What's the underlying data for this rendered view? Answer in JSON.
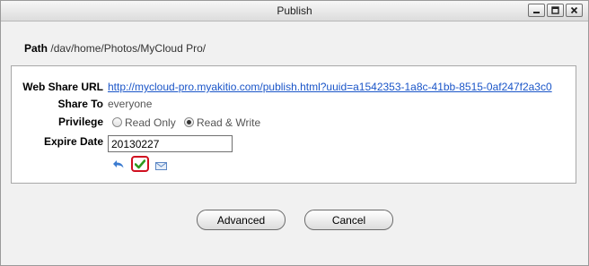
{
  "window": {
    "title": "Publish",
    "controls": [
      "minimize-icon",
      "maximize-icon",
      "close-icon"
    ]
  },
  "path": {
    "label": "Path",
    "value": "/dav/home/Photos/MyCloud Pro/"
  },
  "form": {
    "web_share_url": {
      "label": "Web Share URL",
      "value": "http://mycloud-pro.myakitio.com/publish.html?uuid=a1542353-1a8c-41bb-8515-0af247f2a3c0"
    },
    "share_to": {
      "label": "Share To",
      "value": "everyone"
    },
    "privilege": {
      "label": "Privilege",
      "options": [
        {
          "label": "Read Only",
          "checked": false
        },
        {
          "label": "Read & Write",
          "checked": true
        }
      ]
    },
    "expire_date": {
      "label": "Expire Date",
      "value": "20130227"
    },
    "actions": [
      "undo-icon",
      "confirm-check-icon",
      "email-icon"
    ]
  },
  "buttons": {
    "advanced": "Advanced",
    "cancel": "Cancel"
  },
  "colors": {
    "link": "#1a55c8",
    "check": "#2e9a1e",
    "highlight_ring": "#d01020"
  }
}
